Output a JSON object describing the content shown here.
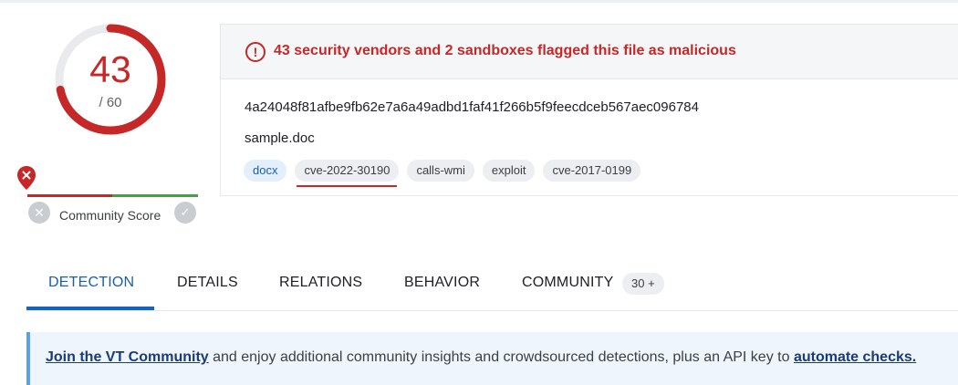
{
  "detection_score": {
    "malicious": "43",
    "total": "/ 60",
    "ratio": 0.7167
  },
  "community_score": {
    "label": "Community Score"
  },
  "alert": {
    "icon": "!",
    "message": "43 security vendors and 2 sandboxes flagged this file as malicious"
  },
  "file": {
    "hash": "4a24048f81afbe9fb62e7a6a49adbd1faf41f266b5f9feecdceb567aec096784",
    "name": "sample.doc",
    "tags": [
      "docx",
      "cve-2022-30190",
      "calls-wmi",
      "exploit",
      "cve-2017-0199"
    ]
  },
  "tabs": {
    "detection": "DETECTION",
    "details": "DETAILS",
    "relations": "RELATIONS",
    "behavior": "BEHAVIOR",
    "community": "COMMUNITY",
    "community_badge": "30 +"
  },
  "banner": {
    "link1": "Join the VT Community",
    "middle": " and enjoy additional community insights and crowdsourced detections, plus an API key to ",
    "link2": "automate checks."
  },
  "colors": {
    "malicious": "#c62828",
    "accent": "#1565c0",
    "harmless": "#43a047"
  }
}
